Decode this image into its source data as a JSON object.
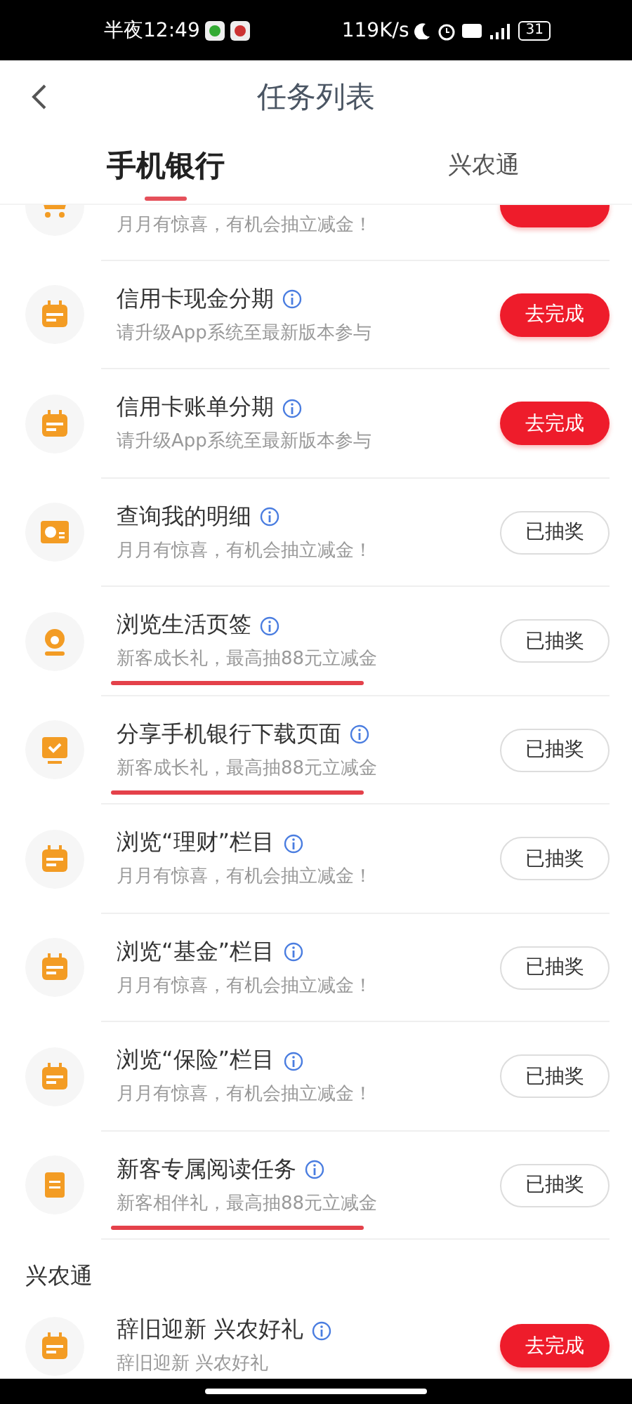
{
  "status_bar": {
    "time": "半夜12:49",
    "speed": "119K/s",
    "battery": "31"
  },
  "header": {
    "title": "任务列表"
  },
  "tabs": [
    {
      "label": "手机银行",
      "selected": true
    },
    {
      "label": "兴农通",
      "selected": false
    }
  ],
  "sections": [
    {
      "rows": [
        {
          "kind": "todo",
          "subtitle": "月月有惊喜，有机会抽立减金！",
          "highlighted": false
        },
        {
          "kind": "todo",
          "title": "信用卡现金分期",
          "subtitle": "请升级App系统至最新版本参与",
          "button": "去完成",
          "highlighted": false
        },
        {
          "kind": "todo",
          "title": "信用卡账单分期",
          "subtitle": "请升级App系统至最新版本参与",
          "button": "去完成",
          "highlighted": false
        },
        {
          "kind": "done",
          "title": "查询我的明细",
          "subtitle": "月月有惊喜，有机会抽立减金！",
          "button": "已抽奖",
          "highlighted": false
        },
        {
          "kind": "done",
          "title": "浏览生活页签",
          "subtitle": "新客成长礼，最高抽88元立减金",
          "button": "已抽奖",
          "highlighted": true
        },
        {
          "kind": "done",
          "title": "分享手机银行下载页面",
          "subtitle": "新客成长礼，最高抽88元立减金",
          "button": "已抽奖",
          "highlighted": true
        },
        {
          "kind": "done",
          "title": "浏览“理财”栏目",
          "subtitle": "月月有惊喜，有机会抽立减金！",
          "button": "已抽奖",
          "highlighted": false
        },
        {
          "kind": "done",
          "title": "浏览“基金”栏目",
          "subtitle": "月月有惊喜，有机会抽立减金！",
          "button": "已抽奖",
          "highlighted": false
        },
        {
          "kind": "done",
          "title": "浏览“保险”栏目",
          "subtitle": "月月有惊喜，有机会抽立减金！",
          "button": "已抽奖",
          "highlighted": false
        },
        {
          "kind": "done",
          "title": "新客专属阅读任务",
          "subtitle": "新客相伴礼，最高抽88元立减金",
          "button": "已抽奖",
          "highlighted": true
        }
      ]
    },
    {
      "heading": "兴农通",
      "rows": [
        {
          "kind": "todo",
          "title": "辞旧迎新 兴农好礼",
          "subtitle": "辞旧迎新 兴农好礼",
          "button": "去完成",
          "highlighted": false
        }
      ]
    }
  ]
}
